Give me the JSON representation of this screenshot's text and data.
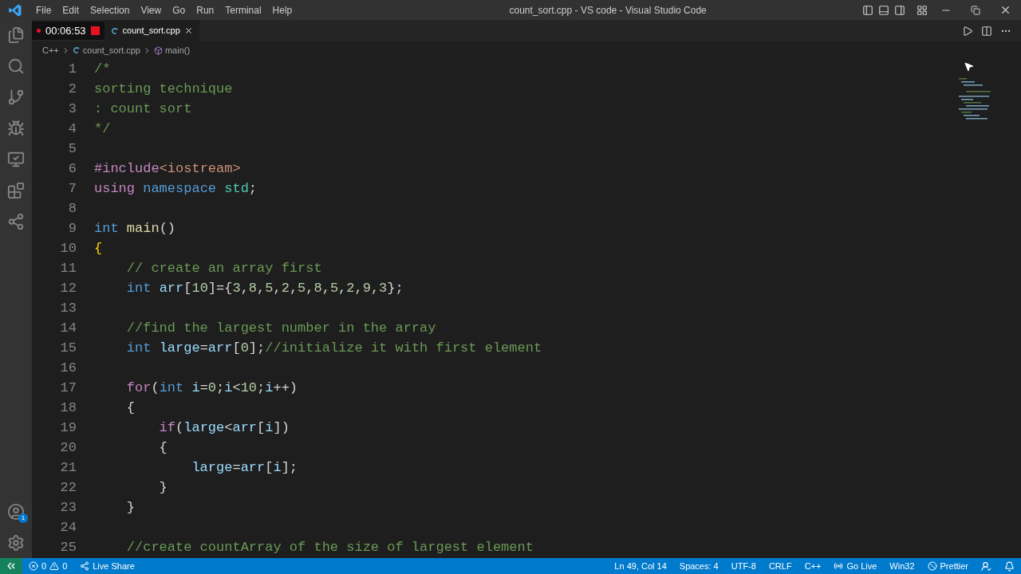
{
  "menu": [
    "File",
    "Edit",
    "Selection",
    "View",
    "Go",
    "Run",
    "Terminal",
    "Help"
  ],
  "window": {
    "title": "count_sort.cpp - VS code - Visual Studio Code"
  },
  "recording": {
    "time": "00:06:53"
  },
  "tabs": [
    {
      "label": "count_sort.cpp",
      "selected": true
    }
  ],
  "breadcrumb": [
    "C++",
    "count_sort.cpp",
    "main()"
  ],
  "lines": [
    {
      "number": "1",
      "tokens": [
        {
          "text": "/*",
          "kind": "comment"
        }
      ]
    },
    {
      "number": "2",
      "tokens": [
        {
          "text": "sorting technique",
          "kind": "comment"
        }
      ]
    },
    {
      "number": "3",
      "tokens": [
        {
          "text": ": count sort",
          "kind": "comment"
        }
      ]
    },
    {
      "number": "4",
      "tokens": [
        {
          "text": "*/",
          "kind": "comment"
        }
      ]
    },
    {
      "number": "5"
    },
    {
      "number": "6",
      "tokens": [
        {
          "text": "#include",
          "kind": "control"
        },
        {
          "text": "<iostream>",
          "kind": "string"
        }
      ]
    },
    {
      "number": "7",
      "tokens": [
        {
          "text": "using ",
          "kind": "control"
        },
        {
          "text": "namespace ",
          "kind": "keyword"
        },
        {
          "text": "std",
          "kind": "type"
        },
        {
          "text": ";",
          "kind": "plain"
        }
      ]
    },
    {
      "number": "8"
    },
    {
      "number": "9",
      "tokens": [
        {
          "text": "int ",
          "kind": "keyword"
        },
        {
          "text": "main",
          "kind": "func"
        },
        {
          "text": "()",
          "kind": "plain"
        }
      ]
    },
    {
      "number": "10",
      "tokens": [
        {
          "text": "{",
          "kind": "bracket"
        }
      ]
    },
    {
      "number": "11",
      "tokens": [
        {
          "text": "    // create an array first",
          "kind": "comment"
        }
      ]
    },
    {
      "number": "12",
      "tokens": [
        {
          "text": "    int ",
          "kind": "keyword"
        },
        {
          "text": "arr",
          "kind": "var"
        },
        {
          "text": "[",
          "kind": "plain"
        },
        {
          "text": "10",
          "kind": "number"
        },
        {
          "text": "]={",
          "kind": "plain"
        },
        {
          "text": "3",
          "kind": "number"
        },
        {
          "text": ",",
          "kind": "plain"
        },
        {
          "text": "8",
          "kind": "number"
        },
        {
          "text": ",",
          "kind": "plain"
        },
        {
          "text": "5",
          "kind": "number"
        },
        {
          "text": ",",
          "kind": "plain"
        },
        {
          "text": "2",
          "kind": "number"
        },
        {
          "text": ",",
          "kind": "plain"
        },
        {
          "text": "5",
          "kind": "number"
        },
        {
          "text": ",",
          "kind": "plain"
        },
        {
          "text": "8",
          "kind": "number"
        },
        {
          "text": ",",
          "kind": "plain"
        },
        {
          "text": "5",
          "kind": "number"
        },
        {
          "text": ",",
          "kind": "plain"
        },
        {
          "text": "2",
          "kind": "number"
        },
        {
          "text": ",",
          "kind": "plain"
        },
        {
          "text": "9",
          "kind": "number"
        },
        {
          "text": ",",
          "kind": "plain"
        },
        {
          "text": "3",
          "kind": "number"
        },
        {
          "text": "};",
          "kind": "plain"
        }
      ]
    },
    {
      "number": "13"
    },
    {
      "number": "14",
      "tokens": [
        {
          "text": "    //find the largest number in the array",
          "kind": "comment"
        }
      ]
    },
    {
      "number": "15",
      "tokens": [
        {
          "text": "    int ",
          "kind": "keyword"
        },
        {
          "text": "large",
          "kind": "var"
        },
        {
          "text": "=",
          "kind": "plain"
        },
        {
          "text": "arr",
          "kind": "var"
        },
        {
          "text": "[",
          "kind": "plain"
        },
        {
          "text": "0",
          "kind": "number"
        },
        {
          "text": "];",
          "kind": "plain"
        },
        {
          "text": "//initialize it with first element",
          "kind": "comment"
        }
      ]
    },
    {
      "number": "16"
    },
    {
      "number": "17",
      "tokens": [
        {
          "text": "    for",
          "kind": "control"
        },
        {
          "text": "(",
          "kind": "plain"
        },
        {
          "text": "int ",
          "kind": "keyword"
        },
        {
          "text": "i",
          "kind": "var"
        },
        {
          "text": "=",
          "kind": "plain"
        },
        {
          "text": "0",
          "kind": "number"
        },
        {
          "text": ";",
          "kind": "plain"
        },
        {
          "text": "i",
          "kind": "var"
        },
        {
          "text": "<",
          "kind": "plain"
        },
        {
          "text": "10",
          "kind": "number"
        },
        {
          "text": ";",
          "kind": "plain"
        },
        {
          "text": "i",
          "kind": "var"
        },
        {
          "text": "++)",
          "kind": "plain"
        }
      ]
    },
    {
      "number": "18",
      "tokens": [
        {
          "text": "    {",
          "kind": "plain"
        }
      ]
    },
    {
      "number": "19",
      "tokens": [
        {
          "text": "        if",
          "kind": "control"
        },
        {
          "text": "(",
          "kind": "plain"
        },
        {
          "text": "large",
          "kind": "var"
        },
        {
          "text": "<",
          "kind": "plain"
        },
        {
          "text": "arr",
          "kind": "var"
        },
        {
          "text": "[",
          "kind": "plain"
        },
        {
          "text": "i",
          "kind": "var"
        },
        {
          "text": "])",
          "kind": "plain"
        }
      ]
    },
    {
      "number": "20",
      "tokens": [
        {
          "text": "        {",
          "kind": "plain"
        }
      ]
    },
    {
      "number": "21",
      "tokens": [
        {
          "text": "            large",
          "kind": "var"
        },
        {
          "text": "=",
          "kind": "plain"
        },
        {
          "text": "arr",
          "kind": "var"
        },
        {
          "text": "[",
          "kind": "plain"
        },
        {
          "text": "i",
          "kind": "var"
        },
        {
          "text": "];",
          "kind": "plain"
        }
      ]
    },
    {
      "number": "22",
      "tokens": [
        {
          "text": "        }",
          "kind": "plain"
        }
      ]
    },
    {
      "number": "23",
      "tokens": [
        {
          "text": "    }",
          "kind": "plain"
        }
      ]
    },
    {
      "number": "24"
    },
    {
      "number": "25",
      "tokens": [
        {
          "text": "    //create countArray of the size of largest element",
          "kind": "comment"
        }
      ]
    }
  ],
  "status_bar": {
    "errors": "0",
    "warnings": "0",
    "live_share": "Live Share",
    "position": "Ln 49, Col 14",
    "spaces": "Spaces: 4",
    "encoding": "UTF-8",
    "eol": "CRLF",
    "language": "C++",
    "go_live": "Go Live",
    "platform": "Win32",
    "prettier": "Prettier"
  },
  "accounts_badge": "1"
}
